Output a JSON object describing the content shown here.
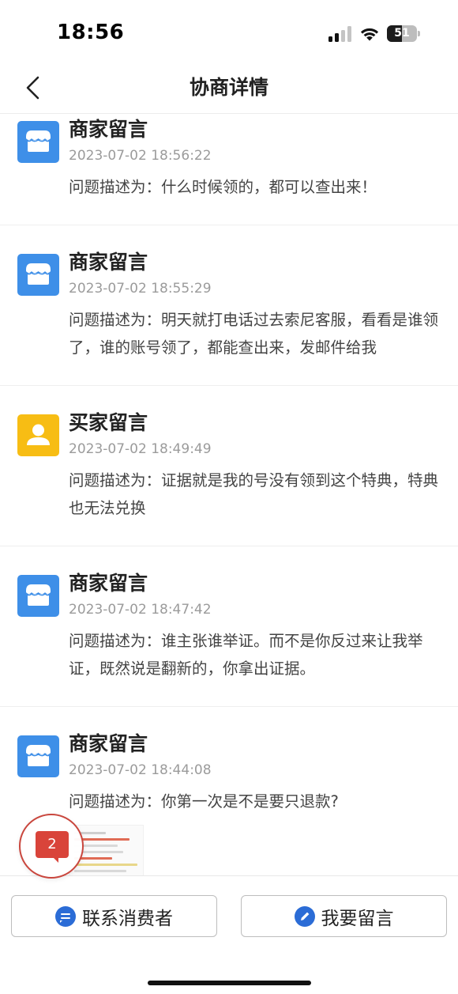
{
  "status_bar": {
    "time": "18:56",
    "battery_level": "51",
    "battery_fraction": 0.51
  },
  "nav": {
    "title": "协商详情",
    "back_icon": "chevron-left-icon"
  },
  "messages": [
    {
      "sender": "商家留言",
      "type": "merchant",
      "avatar_icon": "store-icon",
      "time": "2023-07-02 18:56:22",
      "text": "问题描述为：什么时候领的，都可以查出来！"
    },
    {
      "sender": "商家留言",
      "type": "merchant",
      "avatar_icon": "store-icon",
      "time": "2023-07-02 18:55:29",
      "text": "问题描述为：明天就打电话过去索尼客服，看看是谁领了，谁的账号领了，都能查出来，发邮件给我"
    },
    {
      "sender": "买家留言",
      "type": "buyer",
      "avatar_icon": "user-icon",
      "time": "2023-07-02 18:49:49",
      "text": "问题描述为：证据就是我的号没有领到这个特典，特典也无法兑换"
    },
    {
      "sender": "商家留言",
      "type": "merchant",
      "avatar_icon": "store-icon",
      "time": "2023-07-02 18:47:42",
      "text": "问题描述为：谁主张谁举证。而不是你反过来让我举证，既然说是翻新的，你拿出证据。"
    },
    {
      "sender": "商家留言",
      "type": "merchant",
      "avatar_icon": "store-icon",
      "time": "2023-07-02 18:44:08",
      "text": "问题描述为：你第一次是不是要只退款?"
    }
  ],
  "float_badge": {
    "icon": "chat-bubble-icon",
    "count": "2"
  },
  "bottom_bar": {
    "contact_label": "联系消费者",
    "contact_icon": "message-icon",
    "comment_label": "我要留言",
    "comment_icon": "pencil-icon"
  },
  "colors": {
    "merchant_avatar": "#3e8fe8",
    "buyer_avatar": "#f7bd14",
    "badge_red": "#d9443a",
    "button_icon_blue": "#2b6cd6"
  }
}
